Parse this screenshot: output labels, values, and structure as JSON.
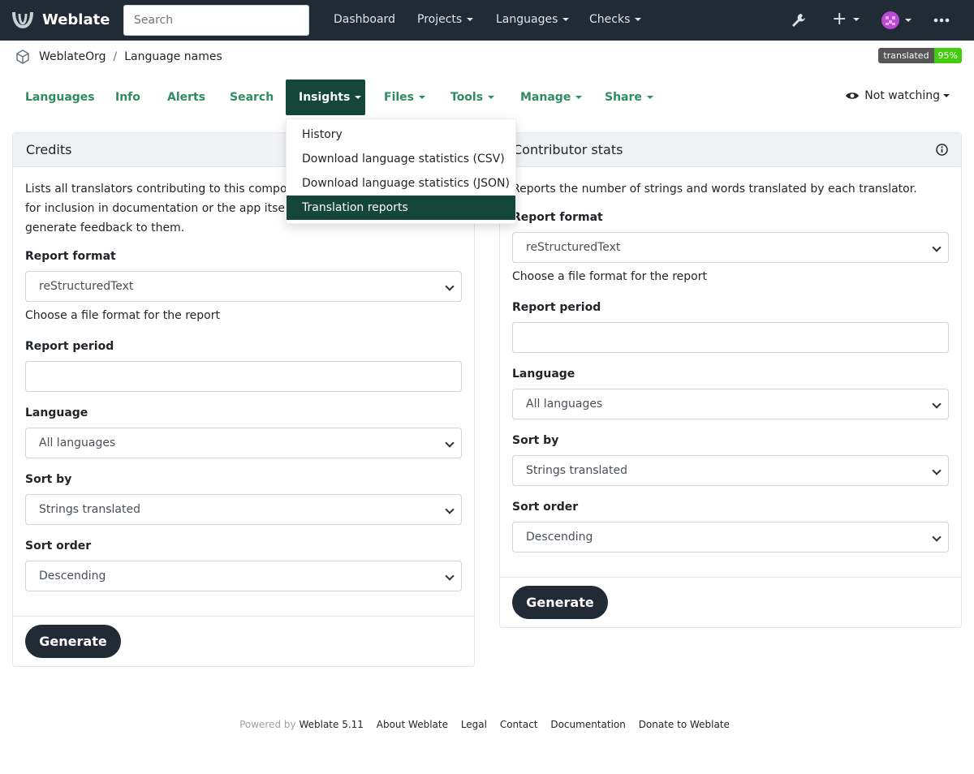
{
  "navbar": {
    "brand": "Weblate",
    "search_placeholder": "Search",
    "items": [
      "Dashboard",
      "Projects",
      "Languages",
      "Checks"
    ]
  },
  "breadcrumb": {
    "project": "WeblateOrg",
    "component": "Language names"
  },
  "badge": {
    "label": "translated",
    "value": "95%"
  },
  "tabs": [
    "Languages",
    "Info",
    "Alerts",
    "Search",
    "Insights",
    "Files",
    "Tools",
    "Manage",
    "Share"
  ],
  "watch_label": "Not watching",
  "dropdown": [
    "History",
    "Download language statistics (CSV)",
    "Download language statistics (JSON)",
    "Translation reports"
  ],
  "credits": {
    "title": "Credits",
    "description": "Lists all translators contributing to this component for inclusion in documentation or the app itself, to generate feedback to them.",
    "desc_lines": [
      "Lists all translators contributing to this compone",
      "for inclusion in documentation or the app itself, t",
      "generate feedback to them."
    ],
    "report_format_label": "Report format",
    "report_format_value": "reStructuredText",
    "report_format_help": "Choose a file format for the report",
    "report_period_label": "Report period",
    "language_label": "Language",
    "language_value": "All languages",
    "sort_by_label": "Sort by",
    "sort_by_value": "Strings translated",
    "sort_order_label": "Sort order",
    "sort_order_value": "Descending",
    "generate": "Generate"
  },
  "contributor": {
    "title": "Contributor stats",
    "description": "Reports the number of strings and words translated by each translator.",
    "report_format_label": "Report format",
    "report_format_value": "reStructuredText",
    "report_format_help": "Choose a file format for the report",
    "report_period_label": "Report period",
    "language_label": "Language",
    "language_value": "All languages",
    "sort_by_label": "Sort by",
    "sort_by_value": "Strings translated",
    "sort_order_label": "Sort order",
    "sort_order_value": "Descending",
    "generate": "Generate"
  },
  "footer": {
    "powered_by": "Powered by",
    "version": "Weblate 5.11",
    "links": [
      "About Weblate",
      "Legal",
      "Contact",
      "Documentation",
      "Donate to Weblate"
    ]
  }
}
